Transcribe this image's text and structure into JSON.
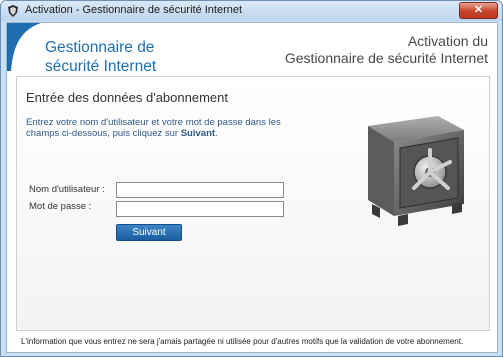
{
  "window": {
    "title": "Activation - Gestionnaire de sécurité Internet",
    "close_glyph": "✕"
  },
  "header": {
    "brand_line1": "Gestionnaire de",
    "brand_line2": "sécurité Internet",
    "title_line1": "Activation du",
    "title_line2": "Gestionnaire de sécurité Internet"
  },
  "form": {
    "section_title": "Entrée des données d'abonnement",
    "description": "Entrez votre nom d'utilisateur et votre mot de passe dans les champs ci-dessous, puis cliquez sur",
    "description_emphasis": "Suivant",
    "description_end": ".",
    "username_label": "Nom d'utilisateur :",
    "username_value": "",
    "password_label": "Mot de passe :",
    "password_value": "",
    "submit_label": "Suivant"
  },
  "footer": {
    "note": "L'information que vous entrez ne sera j'amais partagée ni utilisée pour d'autres motifs que la validation de votre abonnement."
  },
  "icons": {
    "app": "shield-app-icon",
    "art": "safe-vault-icon"
  },
  "colors": {
    "brand_blue": "#1f6fb0",
    "button_blue": "#1b5e9e",
    "close_red": "#c7432a"
  }
}
